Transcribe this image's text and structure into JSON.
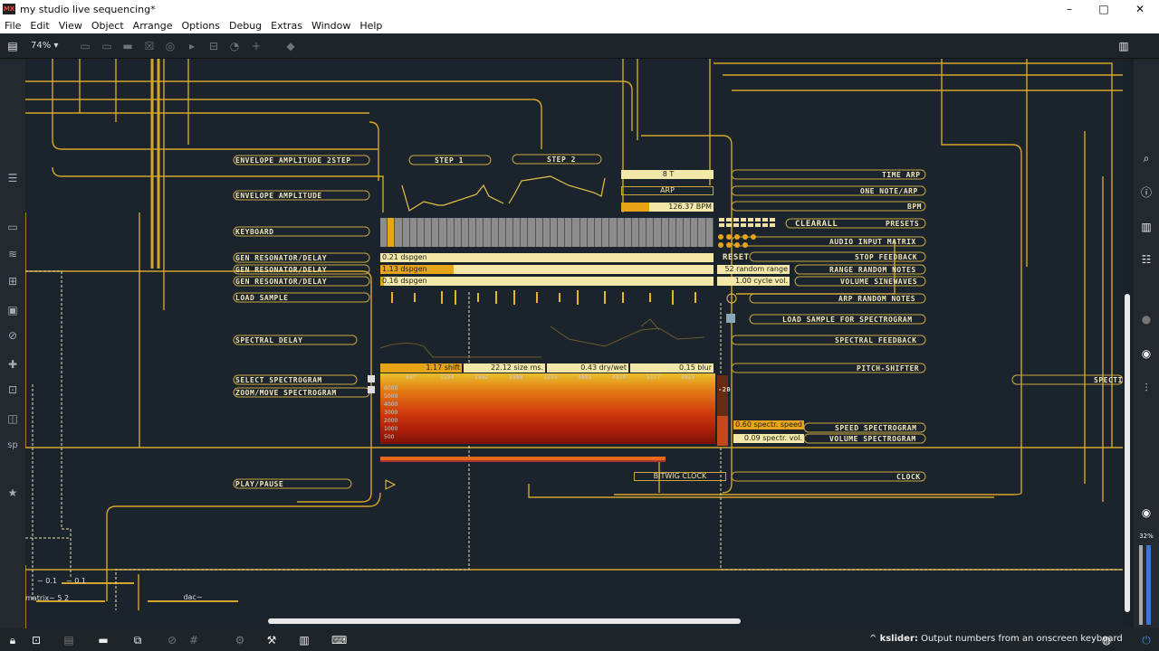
{
  "window": {
    "title": "my studio live sequencing*",
    "logo": "MX",
    "min_glyph": "–",
    "max_glyph": "□",
    "close_glyph": "✕"
  },
  "menu": [
    "File",
    "Edit",
    "View",
    "Object",
    "Arrange",
    "Options",
    "Debug",
    "Extras",
    "Window",
    "Help"
  ],
  "toolbar": {
    "zoom": "74%"
  },
  "patch": {
    "left_labels": [
      "ENVELOPE AMPLITUDE 2STEP",
      "ENVELOPE AMPLITUDE",
      "KEYBOARD",
      "GEN RESONATOR/DELAY",
      "GEN RESONATOR/DELAY",
      "GEN RESONATOR/DELAY",
      "LOAD SAMPLE",
      "SPECTRAL DELAY",
      "SELECT SPECTROGRAM",
      "ZOOM/MOVE SPECTROGRAM",
      "PLAY/PAUSE"
    ],
    "right_labels": [
      "TIME ARP",
      "ONE NOTE/ARP",
      "BPM",
      "PRESETS",
      "AUDIO INPUT MATRIX",
      "STOP FEEDBACK",
      "RANGE RANDOM NOTES",
      "VOLUME SINEWAVES",
      "ARP RANDOM NOTES",
      "LOAD SAMPLE FOR SPECTROGRAM",
      "SPECTRAL FEEDBACK",
      "PITCH-SHIFTER",
      "SPEED SPECTROGRAM",
      "VOLUME SPECTROGRAM",
      "CLOCK"
    ],
    "step1": "STEP 1",
    "step2": "STEP 2",
    "clearall": "CLEARALL",
    "reset": "RESET",
    "spectr_cut": "SPECTI",
    "numboxes": {
      "time_arp": "8 T",
      "arp": "ARP",
      "bpm": "126.37 BPM",
      "res1": "0.21 dspgen",
      "res2": "1.13 dspgen",
      "res3": "0.16 dspgen",
      "random_range": "52 random range",
      "cycle_vol": "1.00 cycle vol.",
      "shift": "1.17 shift",
      "size_ms": "22.12 size ms.",
      "drywet": "0.43 dry/wet",
      "blur": "0.15 blur",
      "spectr_speed": "0.60 spectr. speed",
      "spectr_vol": "0.09 spectr. vol.",
      "bitwig_clock": "BITWIG CLOCK",
      "dac": "dac~",
      "matrix": "matrix~ 5 2",
      "small1": "~ 0.1",
      "small2": "~ 0.1"
    },
    "bpm_fraction": 0.3,
    "res_fractions": [
      0.0,
      0.22,
      0.01
    ],
    "spectro_ticks": [
      "647",
      "1294",
      "1942",
      "2588",
      "3235",
      "3883",
      "4529",
      "5177",
      "5825"
    ],
    "spectro_yticks": [
      "6000",
      "5000",
      "4000",
      "3000",
      "2000",
      "1000",
      "500"
    ],
    "spectro_right": "-20"
  },
  "status": {
    "hint_bold": "kslider:",
    "hint_text": " Output numbers from an onscreen keyboard",
    "volume": "32%"
  },
  "colors": {
    "wire": "#d4a52a",
    "label": "#f2e6b8",
    "numbox": "#f3e8a8",
    "accent": "#e8a418",
    "background": "#1b242c"
  },
  "icons": {
    "sidebar_left": [
      "patcher-icon",
      "list-icon",
      "monitor-icon",
      "waveform-icon",
      "step-icon",
      "image-icon",
      "paperclip-icon",
      "puzzle-icon",
      "connector-icon",
      "package-icon",
      "sp-text",
      "star-icon"
    ],
    "sidebar_right": [
      "search-icon",
      "info-icon",
      "book-icon",
      "list-icon",
      "chat-icon",
      "camera-icon",
      "sliders-icon"
    ]
  }
}
